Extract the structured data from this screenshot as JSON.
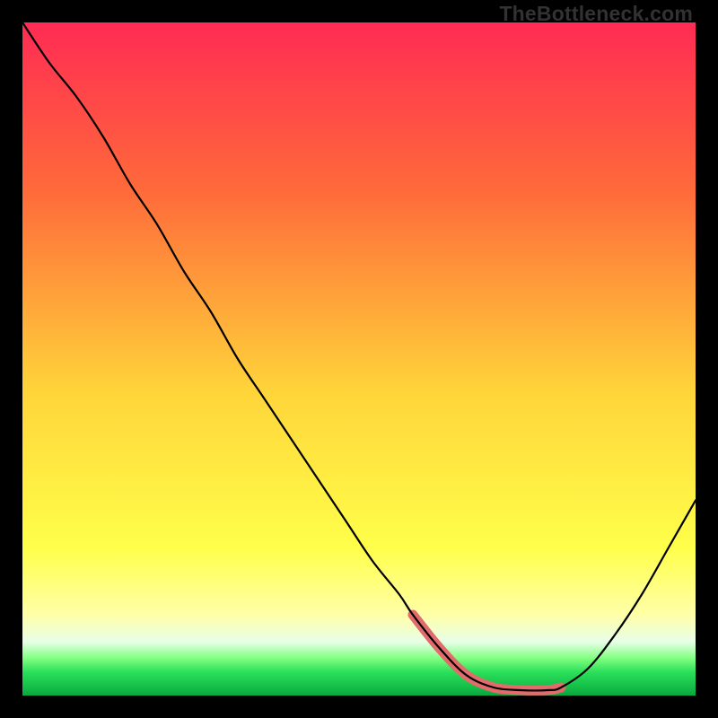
{
  "watermark": "TheBottleneck.com",
  "colors": {
    "curve": "#000000",
    "highlight": "#e36b6b",
    "page_bg": "#000000",
    "grad_top": "#ff2b54",
    "grad_mid1": "#ff6a3a",
    "grad_mid2": "#ffd53a",
    "grad_yellow": "#ffff4a",
    "grad_pale": "#ffffa8",
    "grad_ice": "#e8ffe8",
    "grad_green1": "#7fff7f",
    "grad_green2": "#2bdf5a",
    "grad_green3": "#17c24a",
    "grad_green4": "#0aa63e"
  },
  "chart_data": {
    "type": "line",
    "title": "",
    "xlabel": "",
    "ylabel": "",
    "xlim": [
      0,
      100
    ],
    "ylim": [
      0,
      100
    ],
    "series": [
      {
        "name": "bottleneck-curve",
        "x": [
          0,
          4,
          8,
          12,
          16,
          20,
          24,
          28,
          32,
          36,
          40,
          44,
          48,
          52,
          56,
          58,
          62,
          66,
          70,
          74,
          78,
          80,
          84,
          88,
          92,
          96,
          100
        ],
        "values": [
          100,
          94,
          89,
          83,
          76,
          70,
          63,
          57,
          50,
          44,
          38,
          32,
          26,
          20,
          15,
          12,
          7,
          3,
          1.2,
          0.8,
          0.8,
          1.2,
          4,
          9,
          15,
          22,
          29
        ]
      }
    ],
    "highlight_range_x": [
      58,
      80
    ],
    "highlight_y_at_bottom": 1
  }
}
